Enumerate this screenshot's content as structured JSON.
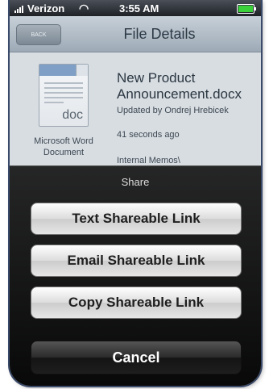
{
  "status_bar": {
    "carrier": "Verizon",
    "time": "3:55 AM"
  },
  "navbar": {
    "back_label": "BACK",
    "title": "File Details"
  },
  "file": {
    "icon_ext": "doc",
    "type": "Microsoft Word Document",
    "name": "New Product Announcement.docx",
    "updated_by": "Updated by Ondrej Hrebicek",
    "modified_ago": "41 seconds ago",
    "folder": "Internal Memos\\"
  },
  "share_sheet": {
    "title": "Share",
    "buttons": [
      {
        "label": "Text Shareable Link"
      },
      {
        "label": "Email Shareable Link"
      },
      {
        "label": "Copy Shareable Link"
      }
    ],
    "cancel_label": "Cancel"
  }
}
